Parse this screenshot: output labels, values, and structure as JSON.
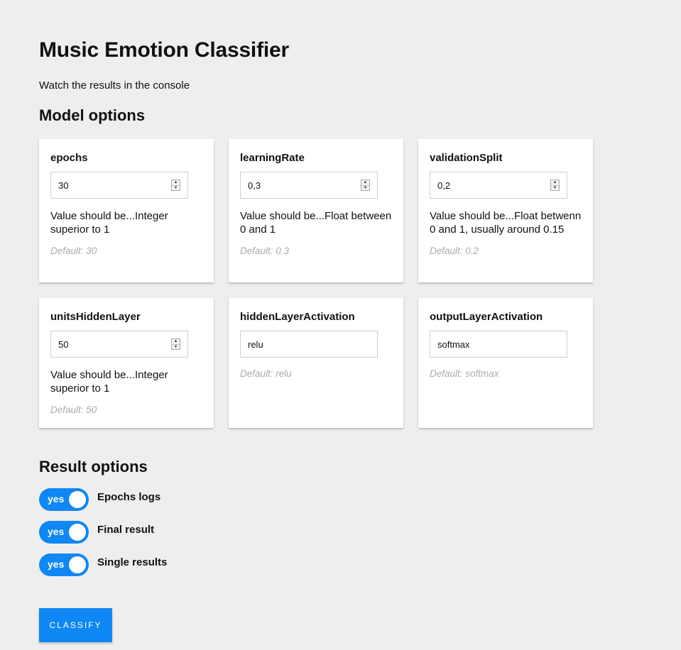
{
  "header": {
    "title": "Music Emotion Classifier",
    "subtitle": "Watch the results in the console"
  },
  "model_options": {
    "heading": "Model options",
    "cards": [
      {
        "label": "epochs",
        "value": "30",
        "type": "number",
        "hint": "Value should be...Integer superior to 1",
        "default": "Default: 30"
      },
      {
        "label": "learningRate",
        "value": "0,3",
        "type": "number",
        "hint": "Value should be...Float between 0 and 1",
        "default": "Default: 0.3"
      },
      {
        "label": "validationSplit",
        "value": "0,2",
        "type": "number",
        "hint": "Value should be...Float betwenn 0 and 1, usually around 0.15",
        "default": "Default: 0.2"
      },
      {
        "label": "unitsHiddenLayer",
        "value": "50",
        "type": "number",
        "hint": "Value should be...Integer superior to 1",
        "default": "Default: 50"
      },
      {
        "label": "hiddenLayerActivation",
        "value": "relu",
        "type": "text",
        "default": "Default: relu"
      },
      {
        "label": "outputLayerActivation",
        "value": "softmax",
        "type": "text",
        "default": "Default: softmax"
      }
    ]
  },
  "result_options": {
    "heading": "Result options",
    "toggles": [
      {
        "state": "yes",
        "label": "Epochs logs"
      },
      {
        "state": "yes",
        "label": "Final result"
      },
      {
        "state": "yes",
        "label": "Single results"
      }
    ]
  },
  "actions": {
    "classify_label": "CLASSIFY"
  },
  "colors": {
    "accent": "#0f87f5",
    "background": "#eeeeee",
    "default_text": "#ababab"
  },
  "icons": {
    "spinner": "number-spinner-icon",
    "toggle_knob": "toggle-knob-icon"
  }
}
